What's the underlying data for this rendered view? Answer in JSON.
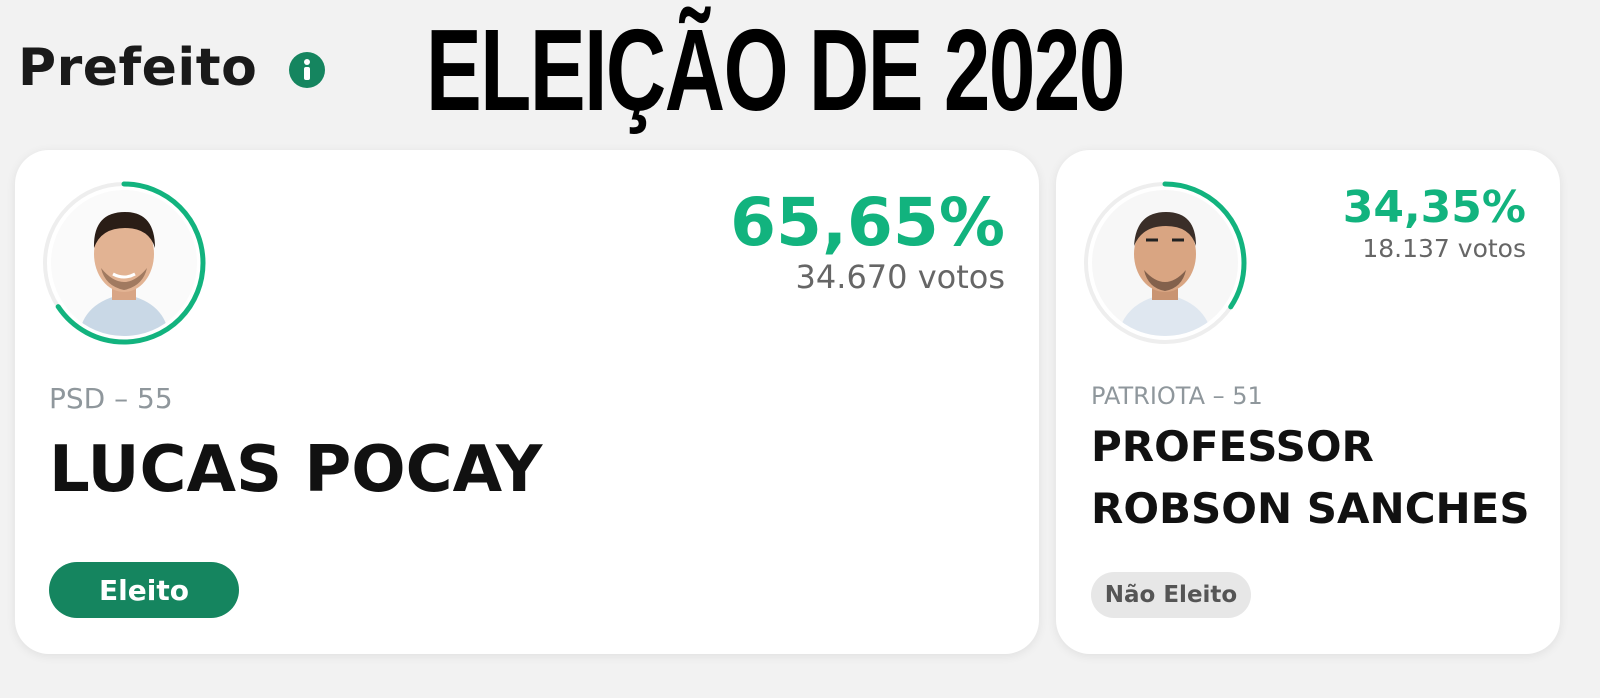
{
  "header": {
    "section_title": "Prefeito",
    "banner_title": "ELEIÇÃO DE 2020"
  },
  "icons": {
    "info": "info-icon"
  },
  "colors": {
    "accent_green": "#12b37e",
    "elected_badge": "#15855f",
    "not_elected_badge": "#e7e7e7",
    "ring_track": "#eeeeee"
  },
  "candidates": [
    {
      "percentage": "65,65%",
      "votes": "34.670 votos",
      "party": "PSD – 55",
      "name": "LUCAS POCAY",
      "status": "Eleito",
      "vote_share": 0.6565
    },
    {
      "percentage": "34,35%",
      "votes": "18.137 votos",
      "party": "PATRIOTA – 51",
      "name_line1": "PROFESSOR",
      "name_line2": "ROBSON SANCHES",
      "status": "Não Eleito",
      "vote_share": 0.3435
    }
  ]
}
